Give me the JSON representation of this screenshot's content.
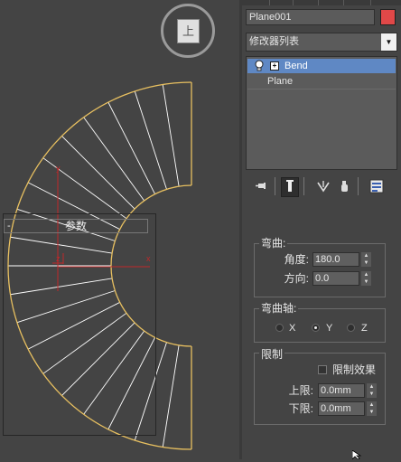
{
  "viewport": {
    "navcube_label": "上",
    "gizmo_axis_y": "y",
    "gizmo_axis_x": "x",
    "gizmo_axis_z": "z"
  },
  "panel": {
    "object_name": "Plane001",
    "object_color": "#e04848",
    "modifier_list": "修改器列表",
    "stack": [
      {
        "label": "Bend",
        "selected": true
      },
      {
        "label": "Plane",
        "selected": false
      }
    ],
    "toolbar_icons": [
      "pin-stack-icon",
      "show-end-result-icon",
      "make-unique-icon",
      "remove-modifier-icon",
      "configure-modifier-sets-icon"
    ]
  },
  "params": {
    "rollout_title": "参数",
    "bend_group": "弯曲:",
    "angle_label": "角度:",
    "angle_value": "180.0",
    "direction_label": "方向:",
    "direction_value": "0.0",
    "axis_group": "弯曲轴:",
    "axis_x": "X",
    "axis_y": "Y",
    "axis_z": "Z",
    "axis_selected": "Y",
    "limits_group": "限制",
    "limit_effect_label": "限制效果",
    "limit_effect_checked": false,
    "upper_label": "上限:",
    "upper_value": "0.0mm",
    "lower_label": "下限:",
    "lower_value": "0.0mm"
  },
  "colors": {
    "viewport_bg": "#444444",
    "wire_outline": "#e8c060",
    "wire_inner": "#ffffff",
    "gizmo": "#c0282a",
    "selection": "#5f88c4"
  }
}
